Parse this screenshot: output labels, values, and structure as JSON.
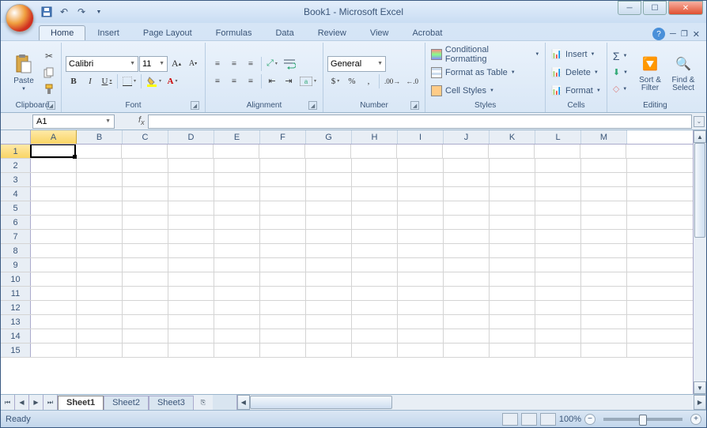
{
  "title": "Book1 - Microsoft Excel",
  "tabs": [
    "Home",
    "Insert",
    "Page Layout",
    "Formulas",
    "Data",
    "Review",
    "View",
    "Acrobat"
  ],
  "active_tab": 0,
  "clipboard": {
    "paste": "Paste",
    "label": "Clipboard"
  },
  "font": {
    "name": "Calibri",
    "size": "11",
    "label": "Font",
    "bold": "B",
    "italic": "I",
    "underline": "U"
  },
  "alignment": {
    "label": "Alignment"
  },
  "number": {
    "format": "General",
    "label": "Number",
    "currency": "$",
    "percent": "%",
    "comma": ","
  },
  "styles": {
    "cond": "Conditional Formatting",
    "table": "Format as Table",
    "cell": "Cell Styles",
    "label": "Styles"
  },
  "cells": {
    "insert": "Insert",
    "delete": "Delete",
    "format": "Format",
    "label": "Cells"
  },
  "editing": {
    "sort": "Sort & Filter",
    "find": "Find & Select",
    "label": "Editing",
    "sigma": "Σ"
  },
  "namebox": "A1",
  "columns": [
    "A",
    "B",
    "C",
    "D",
    "E",
    "F",
    "G",
    "H",
    "I",
    "J",
    "K",
    "L",
    "M"
  ],
  "rows": [
    1,
    2,
    3,
    4,
    5,
    6,
    7,
    8,
    9,
    10,
    11,
    12,
    13,
    14,
    15
  ],
  "active_cell": {
    "row": 0,
    "col": 0
  },
  "sheets": [
    "Sheet1",
    "Sheet2",
    "Sheet3"
  ],
  "active_sheet": 0,
  "status": "Ready",
  "zoom": "100%"
}
